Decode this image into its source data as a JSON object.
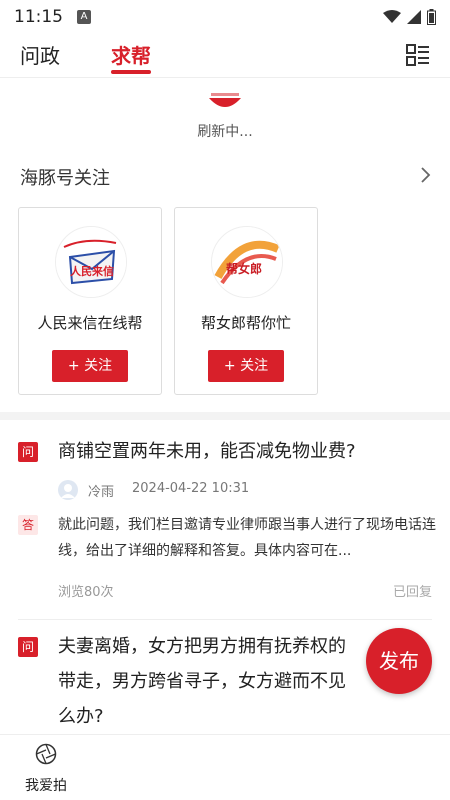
{
  "status_bar": {
    "time": "11:15",
    "app_notification_glyph": "A",
    "icons": [
      "wifi-icon",
      "cellular-signal-icon",
      "battery-icon"
    ]
  },
  "tabs": [
    {
      "label": "问政",
      "active": false
    },
    {
      "label": "求帮",
      "active": true
    }
  ],
  "header": {
    "menu_icon": "grid-list-icon"
  },
  "refresh": {
    "text": "刷新中..."
  },
  "section": {
    "title": "海豚号关注",
    "more_icon": "chevron-right-icon"
  },
  "accounts": [
    {
      "name": "人民来信在线帮",
      "follow_label": "+ 关注",
      "logo_text": "人民来信"
    },
    {
      "name": "帮女郎帮你忙",
      "follow_label": "+ 关注",
      "logo_text": "帮女郎"
    }
  ],
  "questions": [
    {
      "q_badge": "问",
      "title": "商铺空置两年未用，能否减免物业费?",
      "user": "冷雨",
      "time": "2024-04-22 10:31",
      "a_badge": "答",
      "answer": "就此问题，我们栏目邀请专业律师跟当事人进行了现场电话连线，给出了详细的解释和答复。具体内容可在...",
      "views": "浏览80次",
      "status": "已回复"
    },
    {
      "q_badge": "问",
      "title_line1": "夫妻离婚，女方把男方拥有抚养权的",
      "title_line2": "带走，男方跨省寻子，女方避而不见",
      "title_line3": "么办?"
    }
  ],
  "publish_label": "发布",
  "bottom_nav": [
    {
      "label": "我爱拍",
      "icon": "camera-shutter-icon"
    }
  ],
  "colors": {
    "accent": "#d8202a"
  }
}
